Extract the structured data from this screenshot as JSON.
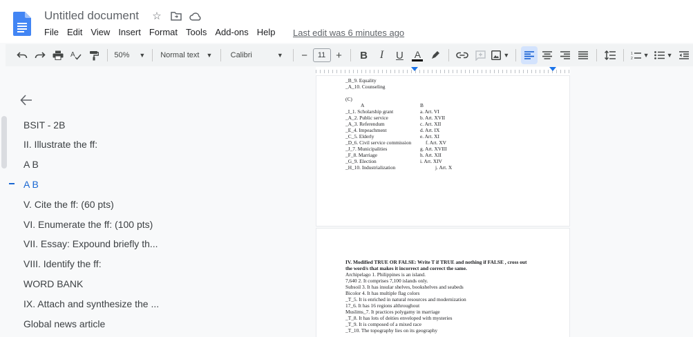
{
  "app": {
    "title": "Untitled document",
    "menu": [
      "File",
      "Edit",
      "View",
      "Insert",
      "Format",
      "Tools",
      "Add-ons",
      "Help"
    ],
    "last_edit": "Last edit was 6 minutes ago"
  },
  "toolbar": {
    "zoom": "50%",
    "style": "Normal text",
    "font": "Calibri",
    "font_size": "11",
    "minus": "−",
    "plus": "+",
    "bold": "B",
    "italic": "I",
    "underline": "U",
    "text_color": "A"
  },
  "outline": {
    "items": [
      {
        "label": "BSIT - 2B"
      },
      {
        "label": "II. Illustrate the ff:"
      },
      {
        "label": "A B"
      },
      {
        "label": "A B"
      },
      {
        "label": "V. Cite the ff: (60 pts)"
      },
      {
        "label": "VI. Enumerate the ff: (100 pts)"
      },
      {
        "label": "VII. Essay: Expound briefly th..."
      },
      {
        "label": "VIII. Identify the ff:"
      },
      {
        "label": "WORD BANK"
      },
      {
        "label": "IX. Attach and synthesize the ..."
      },
      {
        "label": "Global news article"
      }
    ]
  },
  "page1": {
    "lines_top": [
      "_B_9. Equality",
      "_A_10. Counseling"
    ],
    "section_c": "(C)",
    "col_a": "A",
    "col_b": "B",
    "left": [
      "_I_1. Scholarship grant",
      "_A_2. Public service",
      "_A_3. Referendum",
      "_E_4. Impeachment",
      "_C_5. Elderly",
      "_D_6. Civil service commission",
      "_J_7. Municipalities",
      "_F_8. Marriage",
      "_G_9. Election",
      "_H_10. Industrialization"
    ],
    "right": [
      "a. Art. VI",
      "b. Art. XVII",
      "c. Art. XII",
      "d. Art. IX",
      "e. Art. XI",
      "f. Art. XV",
      "g. Art. XVIII",
      "h. Art. XII",
      "i. Art. XIV",
      "j. Art. X"
    ]
  },
  "page2": {
    "heading1": "IV. Modified TRUE OR FALSE: Write T if TRUE and nothing if FALSE , cross out",
    "heading2": "the word/s that makes it incorrect and correct the same.",
    "lines": [
      "Archipelago 1. Philippines is an island.",
      "7,640 2. It comprises 7,100 islands only.",
      "Subsoil 3. It has insular shelves, bookshelves and seabeds",
      "Bicolor 4. It has multiple flag colors",
      "_T_5. It is enriched in natural resources and modernization",
      "17_6. It has 16 regions althroughout",
      "Muslims_7. It practices polygamy in marriage",
      "_T_8. It has lots of deities enveloped with mysteries",
      "_T_9. It is composed of a mixed race",
      "_T_10. The topography lies on its geography"
    ]
  }
}
